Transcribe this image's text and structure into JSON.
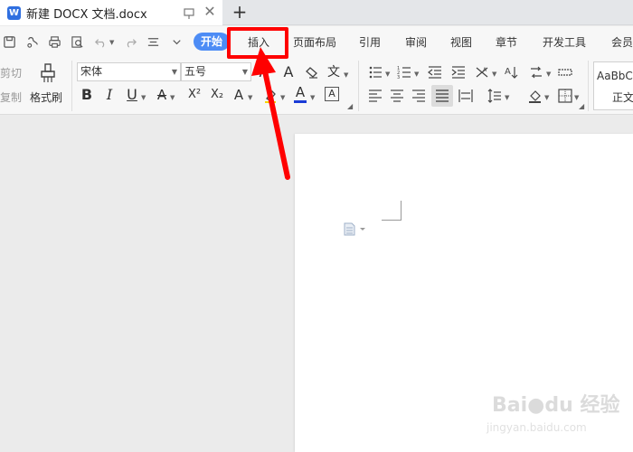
{
  "window": {
    "doc_title": "新建 DOCX 文档.docx",
    "new_tab_label": "+",
    "close_label": "✕"
  },
  "menubar": {
    "items": [
      "开始",
      "插入",
      "页面布局",
      "引用",
      "审阅",
      "视图",
      "章节",
      "开发工具",
      "会员"
    ]
  },
  "toolbar": {
    "cut": "剪切",
    "copy": "复制",
    "format_painter": "格式刷",
    "font_name": "宋体",
    "font_size": "五号",
    "style_preview": "AaBbCc",
    "style_name": "正文",
    "bold": "B",
    "italic": "I",
    "underline": "U",
    "superscript": "X²",
    "subscript": "X₂"
  },
  "highlight_color": "#ff0000",
  "accent_color": "#4d8cf5",
  "watermark": {
    "brand": "Bai",
    "brand2": "du",
    "brand_cn": "经验",
    "url": "jingyan.baidu.com"
  }
}
